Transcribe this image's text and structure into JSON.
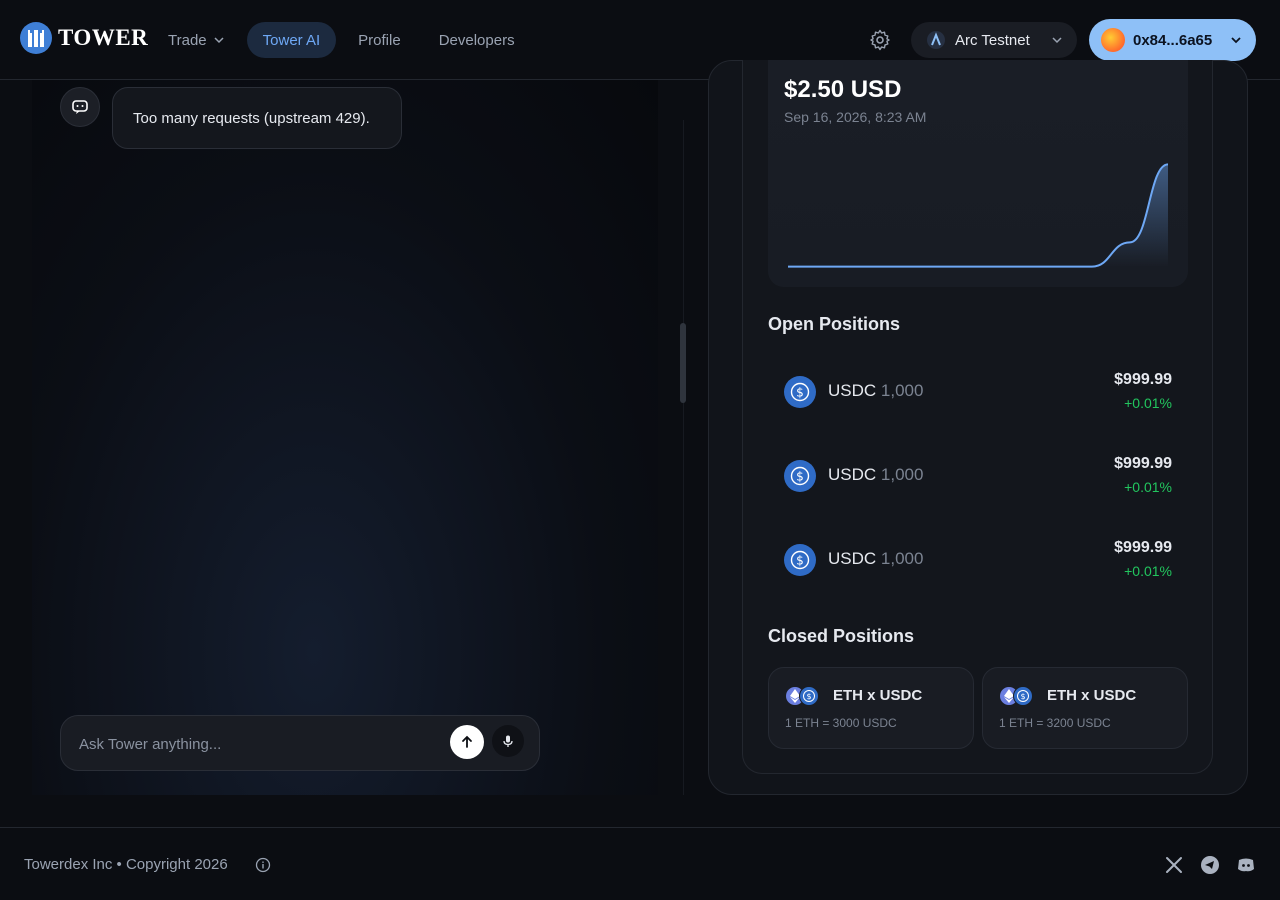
{
  "header": {
    "logo_text": "TOWER",
    "nav": [
      {
        "label": "Trade",
        "has_dropdown": true
      },
      {
        "label": "Tower AI",
        "active": true
      },
      {
        "label": "Profile"
      },
      {
        "label": "Developers"
      }
    ],
    "network_label": "Arc Testnet",
    "wallet_address": "0x84...6a65"
  },
  "chat": {
    "messages": [
      {
        "role": "assistant",
        "text": "Too many requests (upstream 429)."
      }
    ],
    "input_placeholder": "Ask Tower anything..."
  },
  "portfolio": {
    "value": "$2.50 USD",
    "timestamp": "Sep 16, 2026, 8:23 AM",
    "chart_data": {
      "type": "line",
      "x": [
        0,
        1,
        2,
        3,
        4,
        5,
        6,
        7,
        8,
        9,
        10
      ],
      "values": [
        0.01,
        0.01,
        0.01,
        0.01,
        0.01,
        0.01,
        0.01,
        0.01,
        0.01,
        0.6,
        2.5
      ],
      "ylim": [
        0,
        2.8
      ],
      "line_color": "#6ea8f5"
    },
    "open_positions_title": "Open Positions",
    "open_positions": [
      {
        "token": "USDC",
        "amount": "1,000",
        "value": "$999.99",
        "change": "+0.01%"
      },
      {
        "token": "USDC",
        "amount": "1,000",
        "value": "$999.99",
        "change": "+0.01%"
      },
      {
        "token": "USDC",
        "amount": "1,000",
        "value": "$999.99",
        "change": "+0.01%"
      }
    ],
    "closed_positions_title": "Closed Positions",
    "closed_positions": [
      {
        "pair": "ETH x USDC",
        "rate": "1 ETH = 3000 USDC"
      },
      {
        "pair": "ETH x USDC",
        "rate": "1 ETH = 3200 USDC"
      }
    ]
  },
  "footer": {
    "copyright": "Towerdex Inc • Copyright 2026",
    "socials": [
      "x-icon",
      "telegram-icon",
      "discord-icon"
    ]
  },
  "colors": {
    "accent": "#6ea8f5",
    "positive": "#22c55e",
    "usdc": "#2f6bc6",
    "eth": "#6b7fe0"
  }
}
